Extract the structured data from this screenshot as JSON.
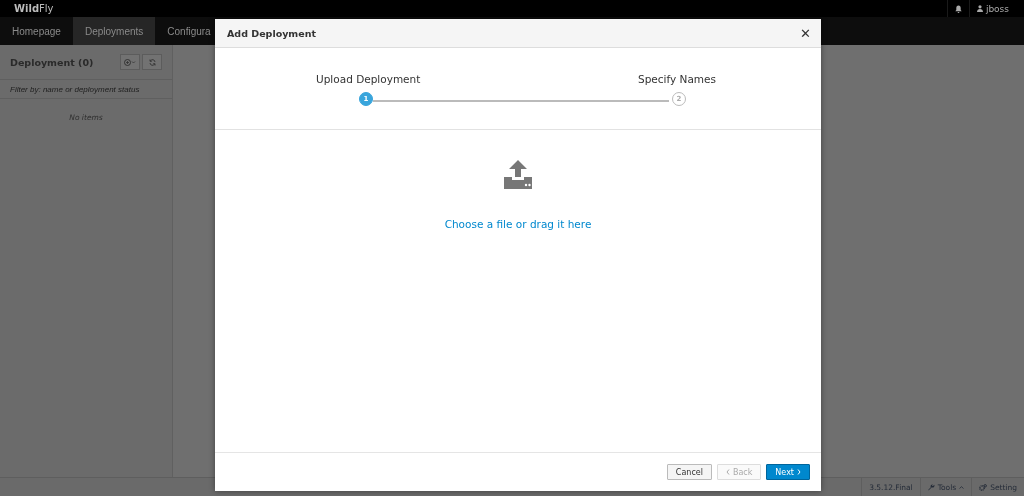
{
  "brand": {
    "bold": "Wild",
    "light": "Fly"
  },
  "user": {
    "name": "jboss"
  },
  "nav": [
    {
      "label": "Homepage",
      "selected": false
    },
    {
      "label": "Deployments",
      "selected": true
    },
    {
      "label": "Configura",
      "selected": false
    }
  ],
  "sidebar": {
    "title": "Deployment (0)",
    "filter": {
      "placeholder": "Filter by: name or deployment status"
    },
    "empty": "No items"
  },
  "status_bar": {
    "version": "3.5.12.Final",
    "tools": "Tools",
    "settings": "Setting"
  },
  "dialog": {
    "title": "Add Deployment",
    "close": "✕",
    "steps": [
      {
        "label": "Upload Deployment",
        "number": "1",
        "selected": true
      },
      {
        "label": "Specify Names",
        "number": "2",
        "selected": false
      }
    ],
    "upload_link": "Choose a file or drag it here",
    "buttons": [
      {
        "kind": "default",
        "label": "Cancel",
        "disabled": false
      },
      {
        "kind": "back",
        "label": "Back",
        "disabled": true
      },
      {
        "kind": "primary",
        "label": "Next",
        "disabled": false
      }
    ]
  }
}
